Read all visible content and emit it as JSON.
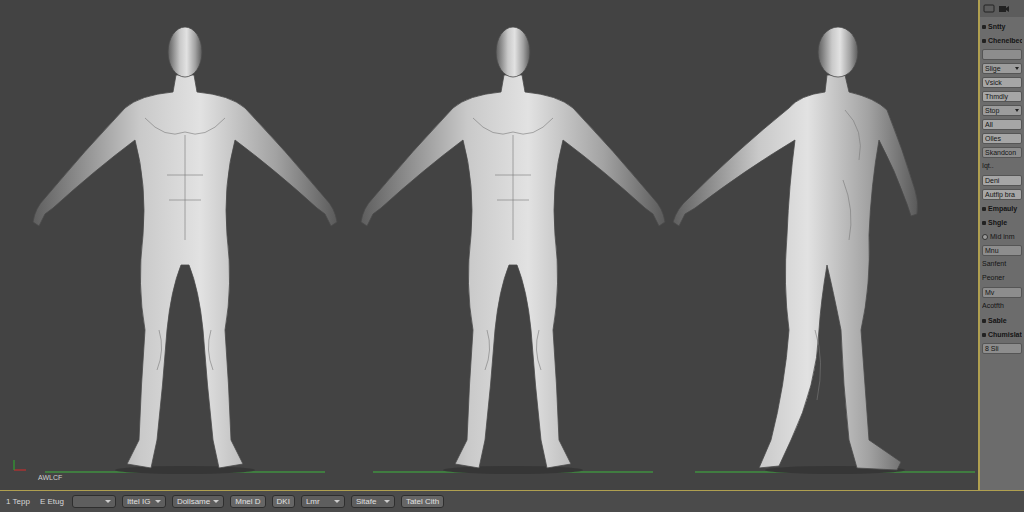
{
  "viewport": {
    "axis_label": "AWLCF",
    "views": [
      {
        "kind": "front"
      },
      {
        "kind": "front"
      },
      {
        "kind": "side"
      }
    ]
  },
  "panel": {
    "items": [
      {
        "kind": "header",
        "text": "Sntty"
      },
      {
        "kind": "header",
        "text": "Chenelbec"
      },
      {
        "kind": "field",
        "text": ""
      },
      {
        "kind": "dropdown",
        "text": "Slige"
      },
      {
        "kind": "button",
        "text": "Vsick"
      },
      {
        "kind": "button",
        "text": "Thmdly"
      },
      {
        "kind": "dropdown",
        "text": "Stop"
      },
      {
        "kind": "button",
        "text": "All"
      },
      {
        "kind": "button",
        "text": "Olles"
      },
      {
        "kind": "field",
        "text": "Skandcon"
      },
      {
        "kind": "label",
        "text": "Iqt.."
      },
      {
        "kind": "button",
        "text": "Deni"
      },
      {
        "kind": "button",
        "text": "Autfip bra"
      },
      {
        "kind": "header",
        "text": "Empauly"
      },
      {
        "kind": "header",
        "text": "Shgle"
      },
      {
        "kind": "check",
        "text": "Mid inm"
      },
      {
        "kind": "field",
        "text": "Mnu"
      },
      {
        "kind": "label",
        "text": "Sanfent"
      },
      {
        "kind": "label",
        "text": "Peoner"
      },
      {
        "kind": "field",
        "text": "Mv"
      },
      {
        "kind": "label",
        "text": "Acotfth"
      },
      {
        "kind": "header",
        "text": "Sable"
      },
      {
        "kind": "header",
        "text": "Chumislat"
      },
      {
        "kind": "field",
        "text": "8 Sli"
      }
    ]
  },
  "status_bar": {
    "items": [
      {
        "kind": "label",
        "text": "1 Tepp"
      },
      {
        "kind": "label",
        "text": "E Etug"
      },
      {
        "kind": "dropdown",
        "text": ""
      },
      {
        "kind": "dropdown",
        "text": "Ittel IG"
      },
      {
        "kind": "dropdown",
        "text": "Dollsame"
      },
      {
        "kind": "button",
        "text": "Mnel D"
      },
      {
        "kind": "button",
        "text": "DKI"
      },
      {
        "kind": "dropdown",
        "text": "Lmr"
      },
      {
        "kind": "dropdown",
        "text": "Sitafe"
      },
      {
        "kind": "button",
        "text": "Tatel Cith"
      }
    ]
  }
}
